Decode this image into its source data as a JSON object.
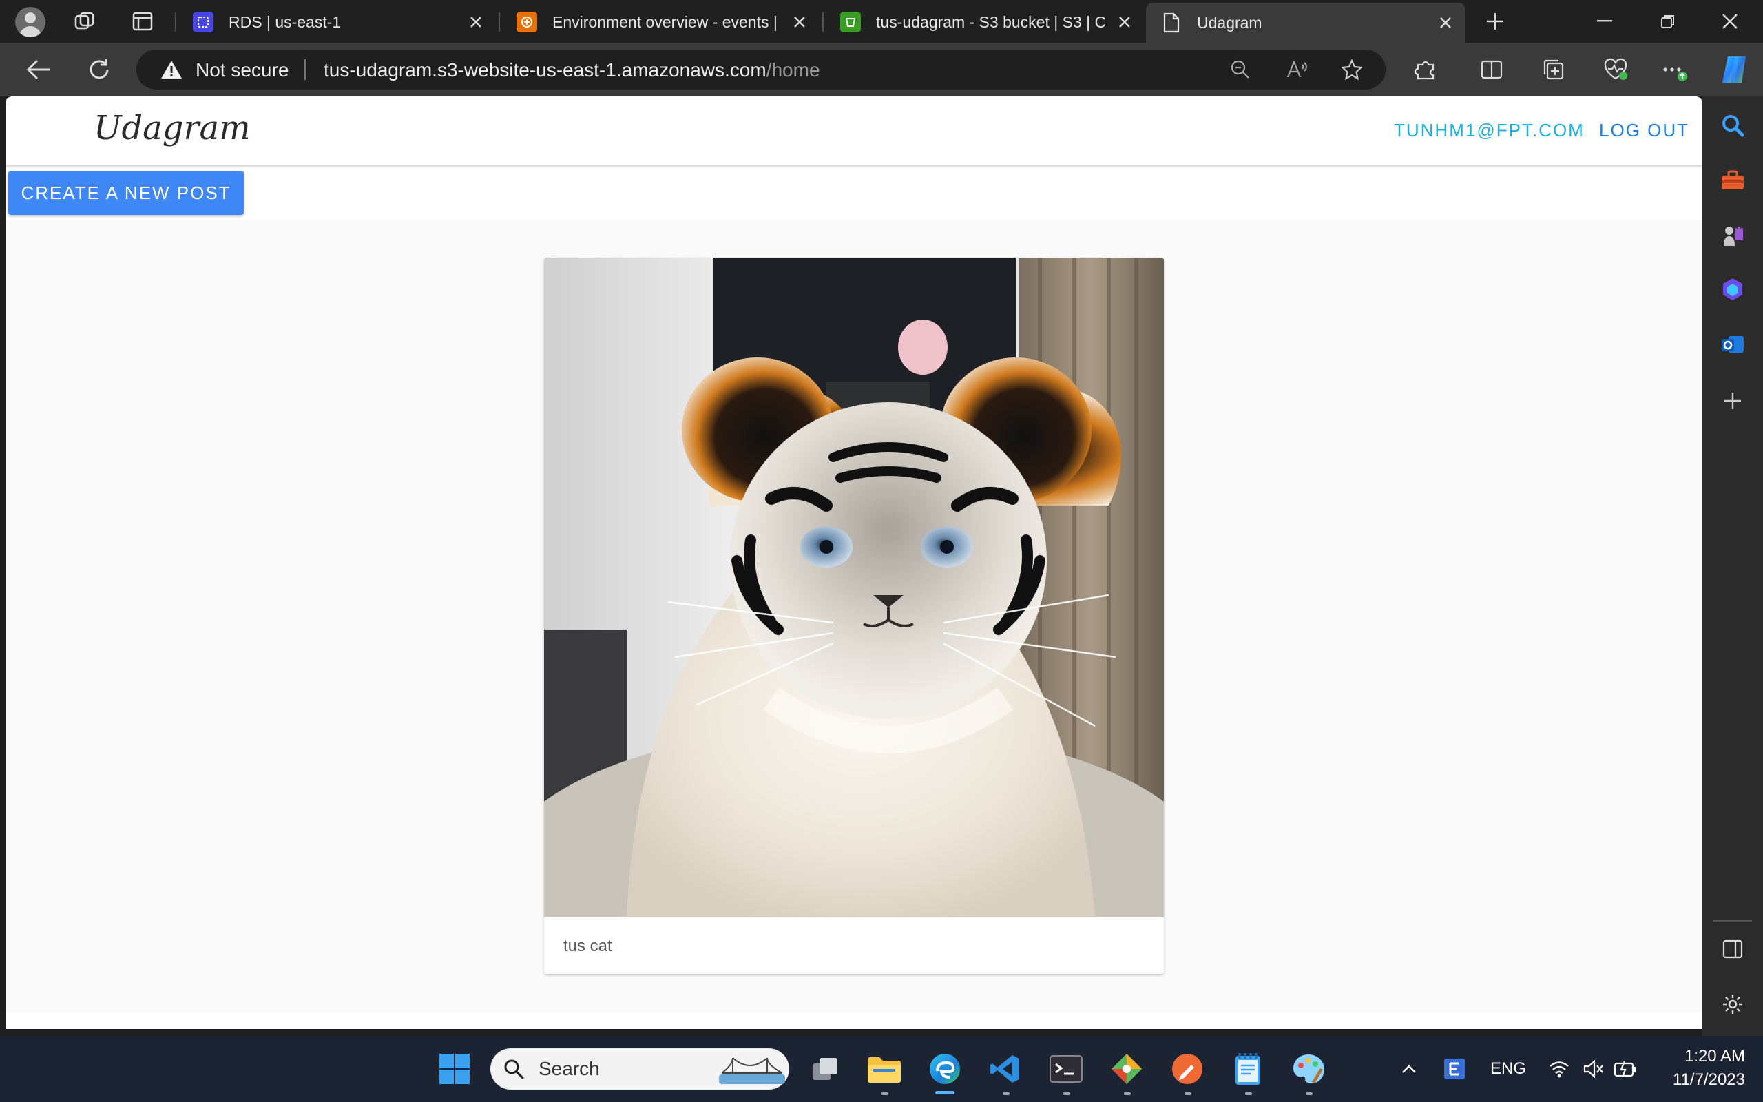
{
  "browser": {
    "tabs": [
      {
        "title": "RDS | us-east-1",
        "favicon": "rds-favicon-icon",
        "active": false
      },
      {
        "title": "Environment overview - events |",
        "favicon": "beanstalk-favicon-icon",
        "active": false
      },
      {
        "title": "tus-udagram - S3 bucket | S3 | C",
        "favicon": "s3-favicon-icon",
        "active": false
      },
      {
        "title": "Udagram",
        "favicon": "page-favicon-icon",
        "active": true
      }
    ],
    "security_label": "Not secure",
    "url_host": "tus-udagram.s3-website-us-east-1.amazonaws.com",
    "url_path": "/home"
  },
  "app": {
    "brand": "Udagram",
    "user_email": "TUNHM1@FPT.COM",
    "logout_label": "LOG OUT",
    "create_post_label": "CREATE A NEW POST",
    "posts": [
      {
        "caption": "tus cat"
      }
    ]
  },
  "taskbar": {
    "search_placeholder": "Search",
    "language": "ENG",
    "time": "1:20 AM",
    "date": "11/7/2023"
  },
  "colors": {
    "accent_blue": "#3f87f5",
    "email_cyan": "#1ab1e0",
    "logout_blue": "#1e7fe0",
    "tab_active_bg": "#3a3a3a",
    "taskbar_bg": "#1c2434"
  }
}
